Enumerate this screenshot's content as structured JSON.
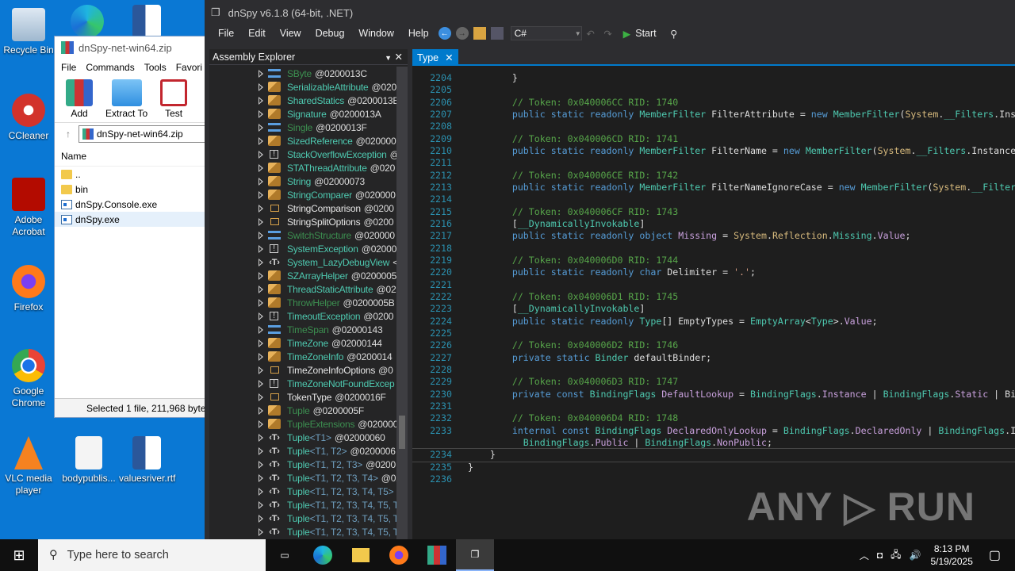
{
  "desktop": {
    "icons": [
      "Recycle Bin",
      "CCleaner",
      "Adobe Acrobat",
      "Firefox",
      "Google Chrome",
      "VLC media player",
      "bodypublis...",
      "valuesriver.rtf"
    ]
  },
  "winrar": {
    "title": "dnSpy-net-win64.zip",
    "menu": [
      "File",
      "Commands",
      "Tools",
      "Favori"
    ],
    "tools": [
      "Add",
      "Extract To",
      "Test"
    ],
    "path": "dnSpy-net-win64.zip",
    "column": "Name",
    "files": [
      {
        "name": "..",
        "type": "folder"
      },
      {
        "name": "bin",
        "type": "folder"
      },
      {
        "name": "dnSpy.Console.exe",
        "type": "exe"
      },
      {
        "name": "dnSpy.exe",
        "type": "exe",
        "selected": true
      }
    ],
    "status": "Selected 1 file, 211,968 bytes"
  },
  "dnspy": {
    "title": "dnSpy v6.1.8 (64-bit, .NET)",
    "menu": [
      "File",
      "Edit",
      "View",
      "Debug",
      "Window",
      "Help"
    ],
    "language": "C#",
    "start": "Start",
    "explorer_title": "Assembly Explorer",
    "tab": "Type",
    "tree": [
      {
        "icon": "struct",
        "name": "SByte",
        "tok": "@0200013C",
        "vis": "int"
      },
      {
        "icon": "class",
        "name": "SerializableAttribute",
        "tok": "@020",
        "vis": "pub"
      },
      {
        "icon": "class",
        "name": "SharedStatics",
        "tok": "@0200013E",
        "vis": "pub"
      },
      {
        "icon": "class",
        "name": "Signature",
        "tok": "@0200013A",
        "vis": "pub"
      },
      {
        "icon": "struct",
        "name": "Single",
        "tok": "@0200013F",
        "vis": "int"
      },
      {
        "icon": "class",
        "name": "SizedReference",
        "tok": "@020000E",
        "vis": "pub"
      },
      {
        "icon": "exc",
        "name": "StackOverflowException",
        "tok": "@",
        "vis": "pub"
      },
      {
        "icon": "class",
        "name": "STAThreadAttribute",
        "tok": "@020",
        "vis": "pub"
      },
      {
        "icon": "class",
        "name": "String",
        "tok": "@02000073",
        "vis": "pub"
      },
      {
        "icon": "class",
        "name": "StringComparer",
        "tok": "@020000",
        "vis": "pub"
      },
      {
        "icon": "enum",
        "name": "StringComparison",
        "tok": "@0200",
        "vis": "en"
      },
      {
        "icon": "enum",
        "name": "StringSplitOptions",
        "tok": "@0200",
        "vis": "en"
      },
      {
        "icon": "struct",
        "name": "SwitchStructure",
        "tok": "@020000",
        "vis": "int"
      },
      {
        "icon": "exc",
        "name": "SystemException",
        "tok": "@02000",
        "vis": "pub"
      },
      {
        "icon": "gen",
        "name": "System_LazyDebugView",
        "tok": "<",
        "vis": "pub"
      },
      {
        "icon": "class",
        "name": "SZArrayHelper",
        "tok": "@0200005",
        "vis": "pub"
      },
      {
        "icon": "class",
        "name": "ThreadStaticAttribute",
        "tok": "@02",
        "vis": "pub"
      },
      {
        "icon": "class",
        "name": "ThrowHelper",
        "tok": "@0200005B",
        "vis": "int"
      },
      {
        "icon": "exc",
        "name": "TimeoutException",
        "tok": "@0200",
        "vis": "pub"
      },
      {
        "icon": "struct",
        "name": "TimeSpan",
        "tok": "@02000143",
        "vis": "int"
      },
      {
        "icon": "class",
        "name": "TimeZone",
        "tok": "@02000144",
        "vis": "pub"
      },
      {
        "icon": "class",
        "name": "TimeZoneInfo",
        "tok": "@0200014",
        "vis": "pub"
      },
      {
        "icon": "enum",
        "name": "TimeZoneInfoOptions",
        "tok": "@0",
        "vis": "en"
      },
      {
        "icon": "exc",
        "name": "TimeZoneNotFoundExcep",
        "tok": "",
        "vis": "pub"
      },
      {
        "icon": "enum",
        "name": "TokenType",
        "tok": "@0200016F",
        "vis": "en"
      },
      {
        "icon": "class",
        "name": "Tuple",
        "tok": "@0200005F",
        "vis": "int"
      },
      {
        "icon": "class",
        "name": "TupleExtensions",
        "tok": "@020000",
        "vis": "int"
      },
      {
        "icon": "gen",
        "name": "Tuple",
        "args": "<T1>",
        "tok": "@02000060",
        "vis": "pub"
      },
      {
        "icon": "gen",
        "name": "Tuple",
        "args": "<T1, T2>",
        "tok": "@0200006",
        "vis": "pub"
      },
      {
        "icon": "gen",
        "name": "Tuple",
        "args": "<T1, T2, T3>",
        "tok": "@0200",
        "vis": "pub"
      },
      {
        "icon": "gen",
        "name": "Tuple",
        "args": "<T1, T2, T3, T4>",
        "tok": "@02",
        "vis": "pub"
      },
      {
        "icon": "gen",
        "name": "Tuple",
        "args": "<T1, T2, T3, T4, T5>",
        "tok": "(",
        "vis": "pub"
      },
      {
        "icon": "gen",
        "name": "Tuple",
        "args": "<T1, T2, T3, T4, T5, T",
        "tok": "",
        "vis": "pub"
      },
      {
        "icon": "gen",
        "name": "Tuple",
        "args": "<T1, T2, T3, T4, T5, T",
        "tok": "",
        "vis": "pub"
      },
      {
        "icon": "gen",
        "name": "Tuple",
        "args": "<T1, T2, T3, T4, T5, T",
        "tok": "",
        "vis": "pub"
      }
    ],
    "code": [
      {
        "n": "2204",
        "s": [
          [
            "p",
            "        }"
          ]
        ]
      },
      {
        "n": "2205",
        "s": []
      },
      {
        "n": "2206",
        "s": [
          [
            "c",
            "        // Token: 0x040006CC RID: 1740"
          ]
        ]
      },
      {
        "n": "2207",
        "s": [
          [
            "k",
            "        public static readonly "
          ],
          [
            "t",
            "MemberFilter"
          ],
          [
            "p",
            " FilterAttribute = "
          ],
          [
            "k",
            "new "
          ],
          [
            "t",
            "MemberFilter"
          ],
          [
            "p",
            "("
          ],
          [
            "y",
            "System"
          ],
          [
            "p",
            "."
          ],
          [
            "t",
            "__Filters"
          ],
          [
            "p",
            ".Ins"
          ]
        ]
      },
      {
        "n": "2208",
        "s": []
      },
      {
        "n": "2209",
        "s": [
          [
            "c",
            "        // Token: 0x040006CD RID: 1741"
          ]
        ]
      },
      {
        "n": "2210",
        "s": [
          [
            "k",
            "        public static readonly "
          ],
          [
            "t",
            "MemberFilter"
          ],
          [
            "p",
            " FilterName = "
          ],
          [
            "k",
            "new "
          ],
          [
            "t",
            "MemberFilter"
          ],
          [
            "p",
            "("
          ],
          [
            "y",
            "System"
          ],
          [
            "p",
            "."
          ],
          [
            "t",
            "__Filters"
          ],
          [
            "p",
            ".Instance"
          ]
        ]
      },
      {
        "n": "2211",
        "s": []
      },
      {
        "n": "2212",
        "s": [
          [
            "c",
            "        // Token: 0x040006CE RID: 1742"
          ]
        ]
      },
      {
        "n": "2213",
        "s": [
          [
            "k",
            "        public static readonly "
          ],
          [
            "t",
            "MemberFilter"
          ],
          [
            "p",
            " FilterNameIgnoreCase = "
          ],
          [
            "k",
            "new "
          ],
          [
            "t",
            "MemberFilter"
          ],
          [
            "p",
            "("
          ],
          [
            "y",
            "System"
          ],
          [
            "p",
            "."
          ],
          [
            "t",
            "__Filter"
          ]
        ]
      },
      {
        "n": "2214",
        "s": []
      },
      {
        "n": "2215",
        "s": [
          [
            "c",
            "        // Token: 0x040006CF RID: 1743"
          ]
        ]
      },
      {
        "n": "2216",
        "s": [
          [
            "p",
            "        ["
          ],
          [
            "t",
            "__DynamicallyInvokable"
          ],
          [
            "p",
            "]"
          ]
        ]
      },
      {
        "n": "2217",
        "s": [
          [
            "k",
            "        public static readonly object "
          ],
          [
            "f",
            "Missing"
          ],
          [
            "p",
            " = "
          ],
          [
            "y",
            "System"
          ],
          [
            "p",
            "."
          ],
          [
            "y",
            "Reflection"
          ],
          [
            "p",
            "."
          ],
          [
            "t",
            "Missing"
          ],
          [
            "p",
            "."
          ],
          [
            "f",
            "Value"
          ],
          [
            "p",
            ";"
          ]
        ]
      },
      {
        "n": "2218",
        "s": []
      },
      {
        "n": "2219",
        "s": [
          [
            "c",
            "        // Token: 0x040006D0 RID: 1744"
          ]
        ]
      },
      {
        "n": "2220",
        "s": [
          [
            "k",
            "        public static readonly char "
          ],
          [
            "p",
            "Delimiter = "
          ],
          [
            "s",
            "'.'"
          ],
          [
            "p",
            ";"
          ]
        ]
      },
      {
        "n": "2221",
        "s": []
      },
      {
        "n": "2222",
        "s": [
          [
            "c",
            "        // Token: 0x040006D1 RID: 1745"
          ]
        ]
      },
      {
        "n": "2223",
        "s": [
          [
            "p",
            "        ["
          ],
          [
            "t",
            "__DynamicallyInvokable"
          ],
          [
            "p",
            "]"
          ]
        ]
      },
      {
        "n": "2224",
        "s": [
          [
            "k",
            "        public static readonly "
          ],
          [
            "t",
            "Type"
          ],
          [
            "p",
            "[] EmptyTypes = "
          ],
          [
            "t",
            "EmptyArray"
          ],
          [
            "p",
            "<"
          ],
          [
            "t",
            "Type"
          ],
          [
            "p",
            ">."
          ],
          [
            "f",
            "Value"
          ],
          [
            "p",
            ";"
          ]
        ]
      },
      {
        "n": "2225",
        "s": []
      },
      {
        "n": "2226",
        "s": [
          [
            "c",
            "        // Token: 0x040006D2 RID: 1746"
          ]
        ]
      },
      {
        "n": "2227",
        "s": [
          [
            "k",
            "        private static "
          ],
          [
            "t",
            "Binder"
          ],
          [
            "p",
            " defaultBinder;"
          ]
        ]
      },
      {
        "n": "2228",
        "s": []
      },
      {
        "n": "2229",
        "s": [
          [
            "c",
            "        // Token: 0x040006D3 RID: 1747"
          ]
        ]
      },
      {
        "n": "2230",
        "s": [
          [
            "k",
            "        private const "
          ],
          [
            "t",
            "BindingFlags"
          ],
          [
            "f",
            " DefaultLookup"
          ],
          [
            "p",
            " = "
          ],
          [
            "t",
            "BindingFlags"
          ],
          [
            "p",
            "."
          ],
          [
            "f",
            "Instance"
          ],
          [
            "p",
            " | "
          ],
          [
            "t",
            "BindingFlags"
          ],
          [
            "p",
            "."
          ],
          [
            "f",
            "Static"
          ],
          [
            "p",
            " | Bi"
          ]
        ]
      },
      {
        "n": "2231",
        "s": []
      },
      {
        "n": "2232",
        "s": [
          [
            "c",
            "        // Token: 0x040006D4 RID: 1748"
          ]
        ]
      },
      {
        "n": "2233",
        "s": [
          [
            "k",
            "        internal const "
          ],
          [
            "t",
            "BindingFlags"
          ],
          [
            "f",
            " DeclaredOnlyLookup"
          ],
          [
            "p",
            " = "
          ],
          [
            "t",
            "BindingFlags"
          ],
          [
            "p",
            "."
          ],
          [
            "f",
            "DeclaredOnly"
          ],
          [
            "p",
            " | "
          ],
          [
            "t",
            "BindingFlags"
          ],
          [
            "p",
            ".I"
          ]
        ]
      },
      {
        "n": "",
        "s": [
          [
            "t",
            "          BindingFlags"
          ],
          [
            "p",
            "."
          ],
          [
            "f",
            "Public"
          ],
          [
            "p",
            " | "
          ],
          [
            "t",
            "BindingFlags"
          ],
          [
            "p",
            "."
          ],
          [
            "f",
            "NonPublic"
          ],
          [
            "p",
            ";"
          ]
        ]
      },
      {
        "n": "2234",
        "s": [
          [
            "p",
            "    }"
          ]
        ],
        "cur": true
      },
      {
        "n": "2235",
        "s": [
          [
            "p",
            "}"
          ]
        ]
      },
      {
        "n": "2236",
        "s": []
      }
    ]
  },
  "taskbar": {
    "search_placeholder": "Type here to search",
    "time": "8:13 PM",
    "date": "5/19/2025"
  },
  "watermark": "ANY RUN"
}
